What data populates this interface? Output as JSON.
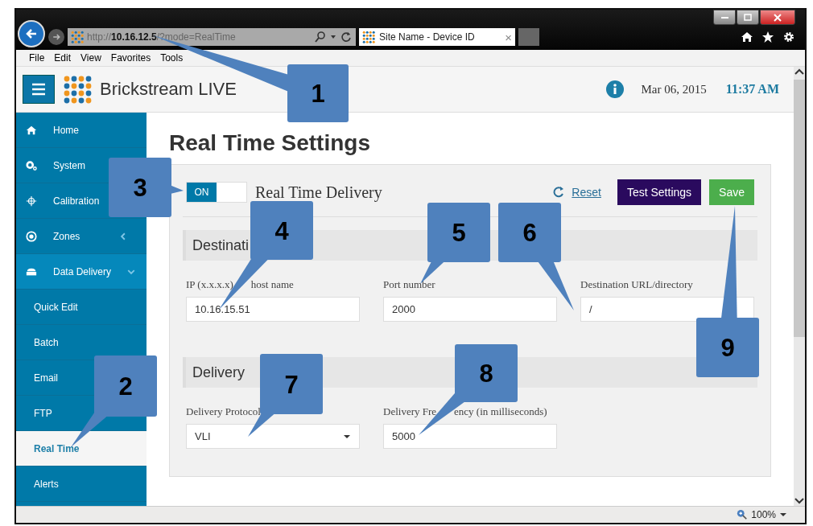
{
  "browser": {
    "address_scheme": "http://",
    "address_host": "10.16.12.5",
    "address_path": "/?mode=RealTime",
    "tab_title": "Site Name - Device ID",
    "tab_close": "×",
    "menu": [
      "File",
      "Edit",
      "View",
      "Favorites",
      "Tools"
    ],
    "zoom": "100%"
  },
  "header": {
    "app_name": "Brickstream LIVE",
    "date": "Mar 06, 2015",
    "time": "11:37 AM"
  },
  "sidebar": {
    "items": [
      {
        "label": "Home",
        "kind": "link",
        "selected": false
      },
      {
        "label": "System",
        "kind": "link",
        "selected": false
      },
      {
        "label": "Calibration",
        "kind": "link",
        "selected": false
      },
      {
        "label": "Zones",
        "kind": "group",
        "expanded": false,
        "selected": false
      },
      {
        "label": "Data Delivery",
        "kind": "group",
        "expanded": true,
        "selected": false,
        "children": [
          {
            "label": "Quick Edit",
            "selected": false
          },
          {
            "label": "Batch",
            "selected": false
          },
          {
            "label": "Email",
            "selected": false
          },
          {
            "label": "FTP",
            "selected": false
          },
          {
            "label": "Real Time",
            "selected": true
          },
          {
            "label": "Alerts",
            "selected": false
          }
        ]
      }
    ]
  },
  "page": {
    "title": "Real Time Settings",
    "toggle": {
      "label": "ON",
      "on": true
    },
    "toggle_caption": "Real Time Delivery",
    "reset": "Reset",
    "buttons": [
      {
        "label": "Test Settings",
        "kind": "secondary"
      },
      {
        "label": "Save",
        "kind": "primary"
      }
    ],
    "sections": [
      {
        "heading": "Destinati",
        "fields": [
          {
            "label_parts": [
              "IP (x.x.x.x)",
              "host name"
            ],
            "kind": "text",
            "value": "10.16.15.51"
          },
          {
            "label_parts": [
              "Port number"
            ],
            "kind": "text",
            "value": "2000"
          },
          {
            "label_parts": [
              "Destination URL/directory"
            ],
            "kind": "text",
            "value": "/"
          }
        ]
      },
      {
        "heading": "Delivery",
        "fields": [
          {
            "label_parts": [
              "Delivery Protocol"
            ],
            "kind": "select",
            "value": "VLI"
          },
          {
            "label_parts": [
              "Delivery Fre",
              "ency (in milliseconds)"
            ],
            "kind": "text",
            "value": "5000"
          }
        ]
      }
    ]
  },
  "callouts": [
    {
      "label": "1"
    },
    {
      "label": "2"
    },
    {
      "label": "3"
    },
    {
      "label": "4"
    },
    {
      "label": "5"
    },
    {
      "label": "6"
    },
    {
      "label": "7"
    },
    {
      "label": "8"
    },
    {
      "label": "9"
    }
  ]
}
